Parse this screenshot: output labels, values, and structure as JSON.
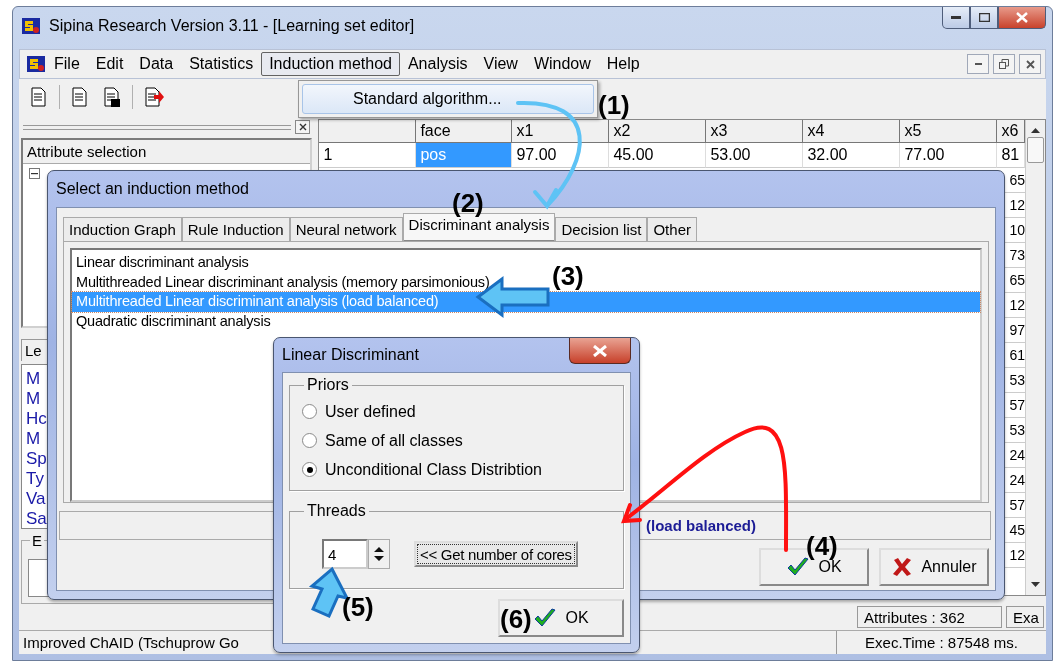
{
  "window": {
    "title": "Sipina Research Version 3.11 - [Learning set editor]"
  },
  "menu": [
    {
      "label": "File",
      "selected": false
    },
    {
      "label": "Edit",
      "selected": false
    },
    {
      "label": "Data",
      "selected": false
    },
    {
      "label": "Statistics",
      "selected": false
    },
    {
      "label": "Induction method",
      "selected": true
    },
    {
      "label": "Analysis",
      "selected": false
    },
    {
      "label": "View",
      "selected": false
    },
    {
      "label": "Window",
      "selected": false
    },
    {
      "label": "Help",
      "selected": false
    }
  ],
  "menu_dropdown": {
    "items": [
      {
        "label": "Standard algorithm...",
        "selected": true
      }
    ]
  },
  "left_panel": {
    "title": "Attribute selection",
    "tab": "Le",
    "items": [
      "M",
      "M",
      "Hc",
      "M",
      "Sp",
      "Ty",
      "Va",
      "Sa"
    ],
    "group": "E"
  },
  "grid": {
    "columns": [
      "face",
      "x1",
      "x2",
      "x3",
      "x4",
      "x5",
      "x6"
    ],
    "rows": [
      {
        "number": "1",
        "cells": [
          {
            "value": "pos",
            "selected": true
          },
          {
            "value": "97.00",
            "selected": false
          },
          {
            "value": "45.00",
            "selected": false
          },
          {
            "value": "53.00",
            "selected": false
          },
          {
            "value": "32.00",
            "selected": false
          },
          {
            "value": "77.00",
            "selected": false
          },
          {
            "value": "81",
            "selected": false
          }
        ]
      }
    ],
    "x6_column_tail": [
      "65",
      "12",
      "10",
      "73",
      "65",
      "12",
      "97",
      "61",
      "53",
      "57",
      "53",
      "24",
      "24",
      "57",
      "45",
      "12"
    ]
  },
  "child_status_bar": [
    "Attributes : 362",
    "Exa"
  ],
  "status_bar": [
    "Improved ChAID (Tschuprow Go",
    "Exec.Time : 87548 ms."
  ],
  "method_dialog": {
    "title": "Select an induction method",
    "tabs": [
      {
        "label": "Induction Graph",
        "selected": false
      },
      {
        "label": "Rule Induction",
        "selected": false
      },
      {
        "label": "Neural network",
        "selected": false
      },
      {
        "label": "Discriminant analysis",
        "selected": true
      },
      {
        "label": "Decision list",
        "selected": false
      },
      {
        "label": "Other",
        "selected": false
      }
    ],
    "methods": [
      {
        "label": "Linear discriminant analysis",
        "selected": false
      },
      {
        "label": "Multithreaded Linear discriminant analysis (memory parsimonious)",
        "selected": false
      },
      {
        "label": "Multithreaded Linear discriminant analysis (load balanced)",
        "selected": true
      },
      {
        "label": "Quadratic discriminant analysis",
        "selected": false
      }
    ],
    "status": "(load balanced)",
    "buttons": [
      {
        "kind": "ok",
        "label": "OK"
      },
      {
        "kind": "cancel",
        "label": "Annuler"
      }
    ]
  },
  "lda_dialog": {
    "title": "Linear Discriminant",
    "priors": {
      "title": "Priors",
      "options": [
        {
          "label": "User defined",
          "selected": false
        },
        {
          "label": "Same of all classes",
          "selected": false
        },
        {
          "label": "Unconditional Class Distribtion",
          "selected": true
        }
      ]
    },
    "threads": {
      "title": "Threads",
      "value": "4",
      "cores_button": "<< Get number of cores"
    },
    "ok_button": "OK"
  },
  "annotations": [
    "(1)",
    "(2)",
    "(3)",
    "(4)",
    "(5)",
    "(6)"
  ]
}
